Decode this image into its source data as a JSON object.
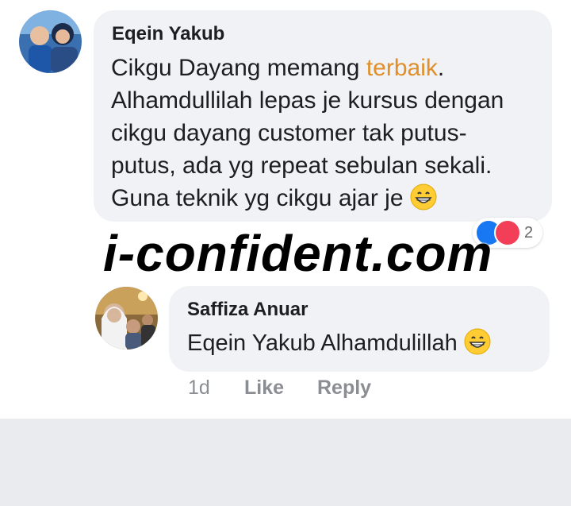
{
  "comment": {
    "author": "Eqein Yakub",
    "lines": [
      {
        "before": "Cikgu Dayang memang ",
        "highlight": "terbaik",
        "after": "."
      },
      {
        "text": "Alhamdullilah lepas je kursus dengan"
      },
      {
        "text": "cikgu dayang customer tak putus-"
      },
      {
        "text": "putus, ada yg repeat sebulan sekali."
      },
      {
        "text": "Guna teknik yg cikgu ajar je"
      }
    ],
    "reactions": {
      "count": "2",
      "types": [
        "like-icon",
        "heart-icon"
      ]
    },
    "emoji": "grinning-face-icon"
  },
  "watermark": "i-confident.com",
  "reply": {
    "author": "Saffiza Anuar",
    "mention": "Eqein Yakub",
    "text": "Alhamdulillah",
    "emoji": "grinning-face-icon",
    "actions": {
      "time": "1d",
      "like": "Like",
      "reply": "Reply"
    }
  },
  "colors": {
    "highlight": "#e18f28",
    "bubble": "#f0f2f5",
    "muted": "#8a8d91",
    "like": "#1877f2",
    "heart": "#f33e58",
    "background": "#e9ebee"
  }
}
